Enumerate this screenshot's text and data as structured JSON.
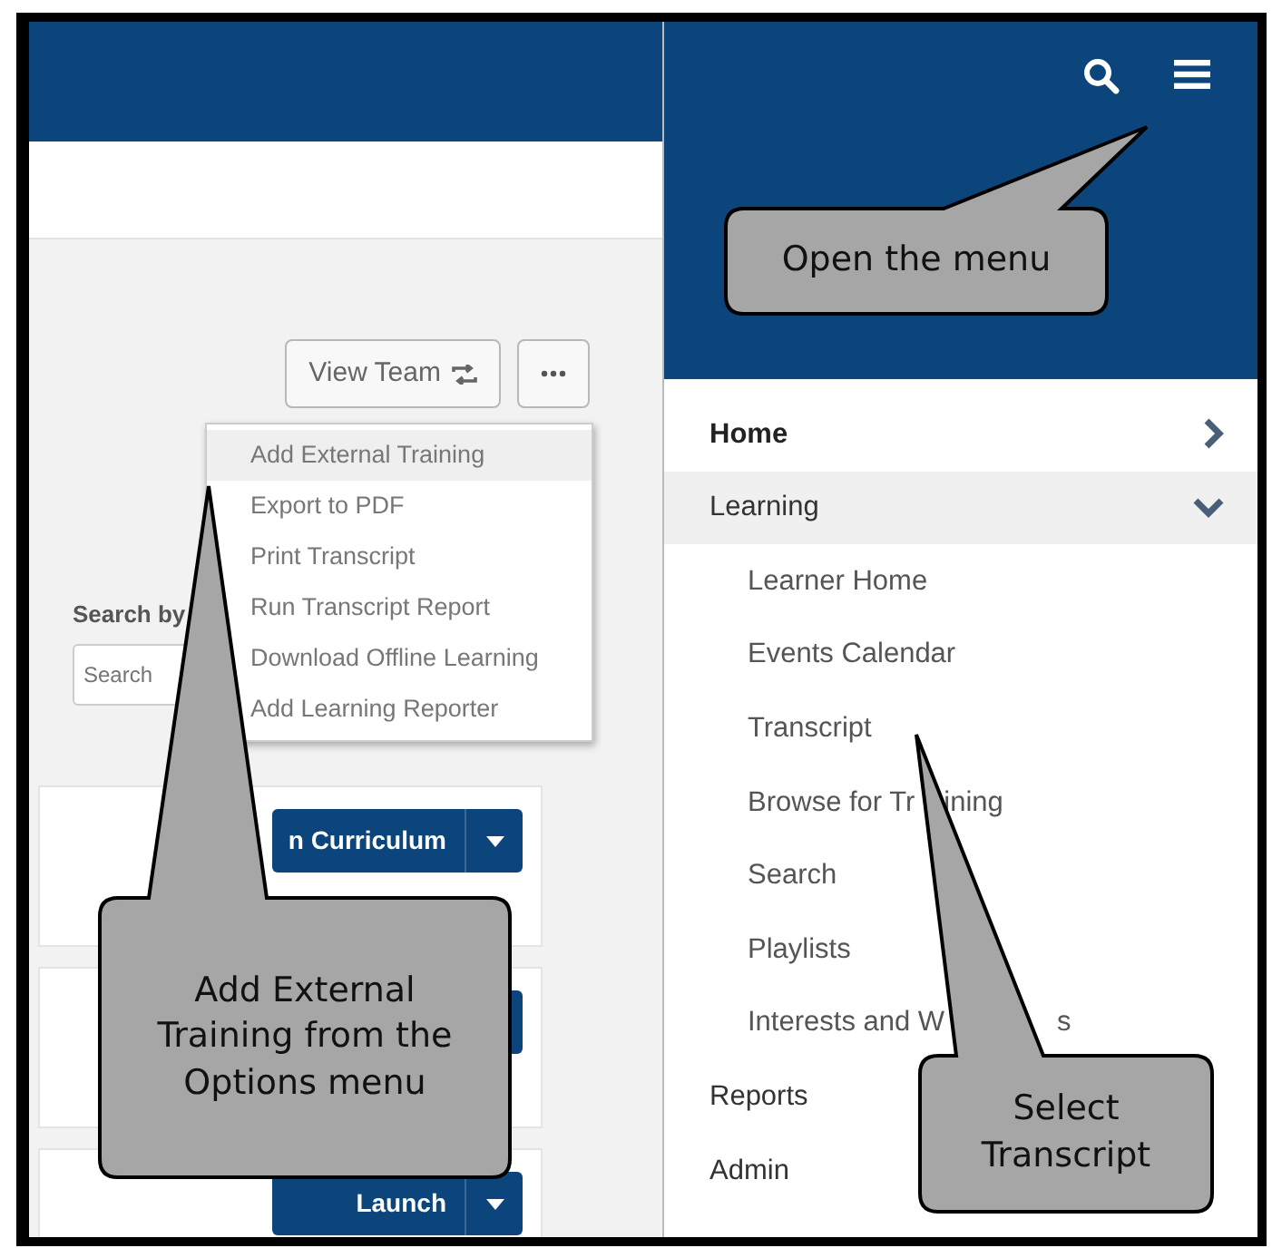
{
  "toolbar": {
    "view_team_button": "View Team"
  },
  "options_menu": {
    "items": [
      {
        "label": "Add External Training",
        "selected": true
      },
      {
        "label": "Export to PDF",
        "selected": false
      },
      {
        "label": "Print Transcript",
        "selected": false
      },
      {
        "label": "Run Transcript Report",
        "selected": false
      },
      {
        "label": "Download Offline Learning",
        "selected": false
      },
      {
        "label": "Add Learning Reporter",
        "selected": false
      }
    ]
  },
  "search": {
    "label": "Search by",
    "placeholder": "Search"
  },
  "cards": [
    {
      "kind": "labeled",
      "button": "n Curriculum"
    },
    {
      "kind": "covered"
    },
    {
      "kind": "labeled",
      "button": "Launch"
    }
  ],
  "nav": {
    "items": [
      {
        "label": "Home",
        "selected": true,
        "expanded": false
      },
      {
        "label": "Learning",
        "selected": false,
        "expanded": true,
        "children": [
          {
            "parts": [
              "Learner Home"
            ]
          },
          {
            "parts": [
              "Events Calendar"
            ]
          },
          {
            "parts": [
              "Transcript"
            ]
          },
          {
            "parts": [
              "Browse for Tr",
              "ining"
            ]
          },
          {
            "parts": [
              "Search"
            ]
          },
          {
            "parts": [
              "Playlists"
            ]
          },
          {
            "parts": [
              "Interests and W",
              "s"
            ]
          }
        ]
      },
      {
        "label": "Reports",
        "selected": false
      },
      {
        "label": "Admin",
        "selected": false
      }
    ]
  },
  "callouts": [
    {
      "text": "Add External Training from the Options menu"
    },
    {
      "text": "Open the menu"
    },
    {
      "text": "Select Transcript"
    }
  ]
}
